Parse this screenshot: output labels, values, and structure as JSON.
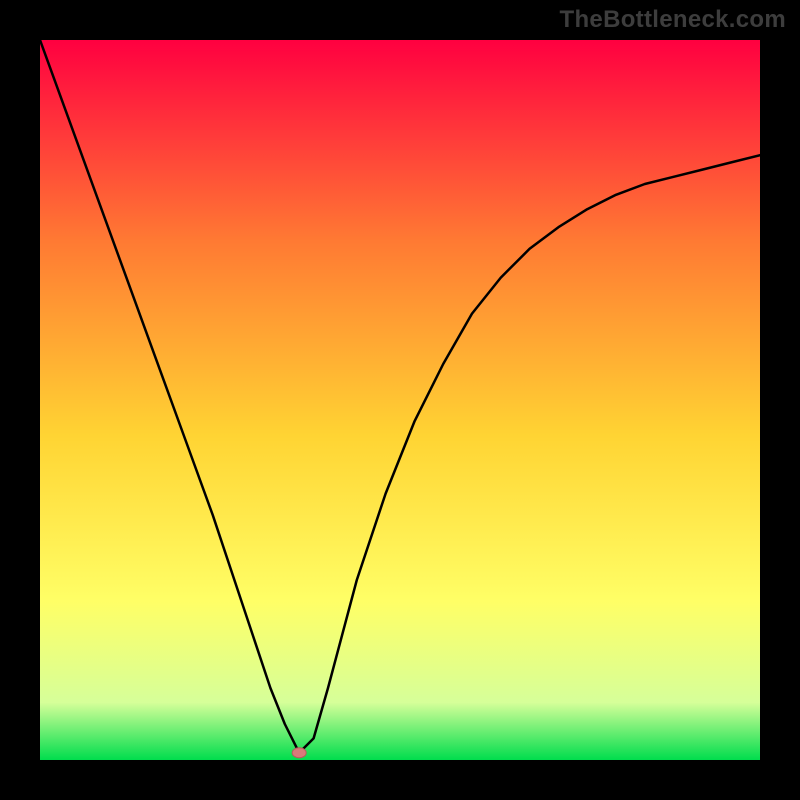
{
  "watermark": "TheBottleneck.com",
  "chart_data": {
    "type": "line",
    "title": "",
    "xlabel": "",
    "ylabel": "",
    "xlim": [
      0,
      100
    ],
    "ylim": [
      0,
      100
    ],
    "x": [
      0,
      4,
      8,
      12,
      16,
      20,
      24,
      28,
      30,
      32,
      34,
      36,
      38,
      40,
      44,
      48,
      52,
      56,
      60,
      64,
      68,
      72,
      76,
      80,
      84,
      88,
      92,
      96,
      100
    ],
    "y": [
      100,
      89,
      78,
      67,
      56,
      45,
      34,
      22,
      16,
      10,
      5,
      1,
      3,
      10,
      25,
      37,
      47,
      55,
      62,
      67,
      71,
      74,
      76.5,
      78.5,
      80,
      81,
      82,
      83,
      84
    ],
    "minimum_x": 36,
    "minimum_y": 1,
    "marker": {
      "x": 36,
      "y": 1
    },
    "background_gradient": {
      "top": "#ff0040",
      "mid_top": "#ff7a33",
      "mid": "#ffd433",
      "mid_low": "#ffff66",
      "low": "#d6ff99",
      "bottom": "#00dd4d"
    }
  }
}
